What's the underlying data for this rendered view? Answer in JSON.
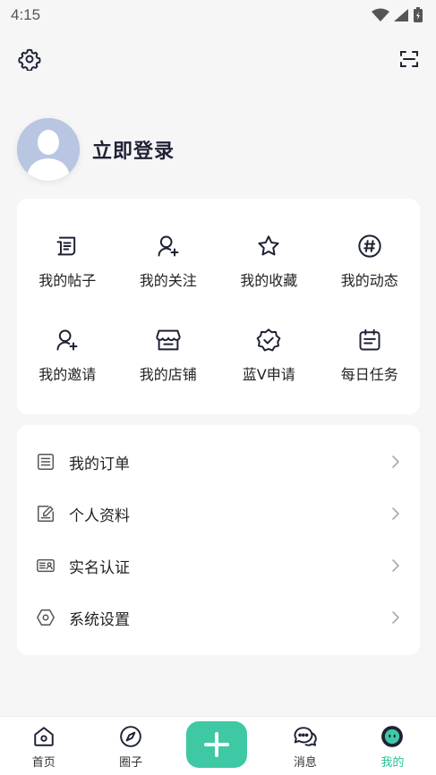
{
  "status_bar": {
    "time": "4:15"
  },
  "profile": {
    "login_label": "立即登录"
  },
  "grid": {
    "items": [
      {
        "label": "我的帖子",
        "icon": "post-icon"
      },
      {
        "label": "我的关注",
        "icon": "follow-user-icon"
      },
      {
        "label": "我的收藏",
        "icon": "star-icon"
      },
      {
        "label": "我的动态",
        "icon": "hashtag-icon"
      },
      {
        "label": "我的邀请",
        "icon": "invite-user-icon"
      },
      {
        "label": "我的店铺",
        "icon": "shop-icon"
      },
      {
        "label": "蓝V申请",
        "icon": "verified-badge-icon"
      },
      {
        "label": "每日任务",
        "icon": "calendar-icon"
      }
    ]
  },
  "list": {
    "items": [
      {
        "label": "我的订单",
        "icon": "order-list-icon"
      },
      {
        "label": "个人资料",
        "icon": "edit-profile-icon"
      },
      {
        "label": "实名认证",
        "icon": "id-card-icon"
      },
      {
        "label": "系统设置",
        "icon": "hexagon-settings-icon"
      }
    ]
  },
  "tabbar": {
    "tabs": [
      {
        "label": "首页",
        "icon": "home-icon"
      },
      {
        "label": "圈子",
        "icon": "compass-icon"
      },
      {
        "label": "消息",
        "icon": "chat-icon"
      },
      {
        "label": "我的",
        "icon": "face-icon",
        "active": true
      }
    ]
  },
  "colors": {
    "accent": "#3ec9a4",
    "active_tab": "#2cc09a",
    "icon_dark": "#1e2235"
  }
}
